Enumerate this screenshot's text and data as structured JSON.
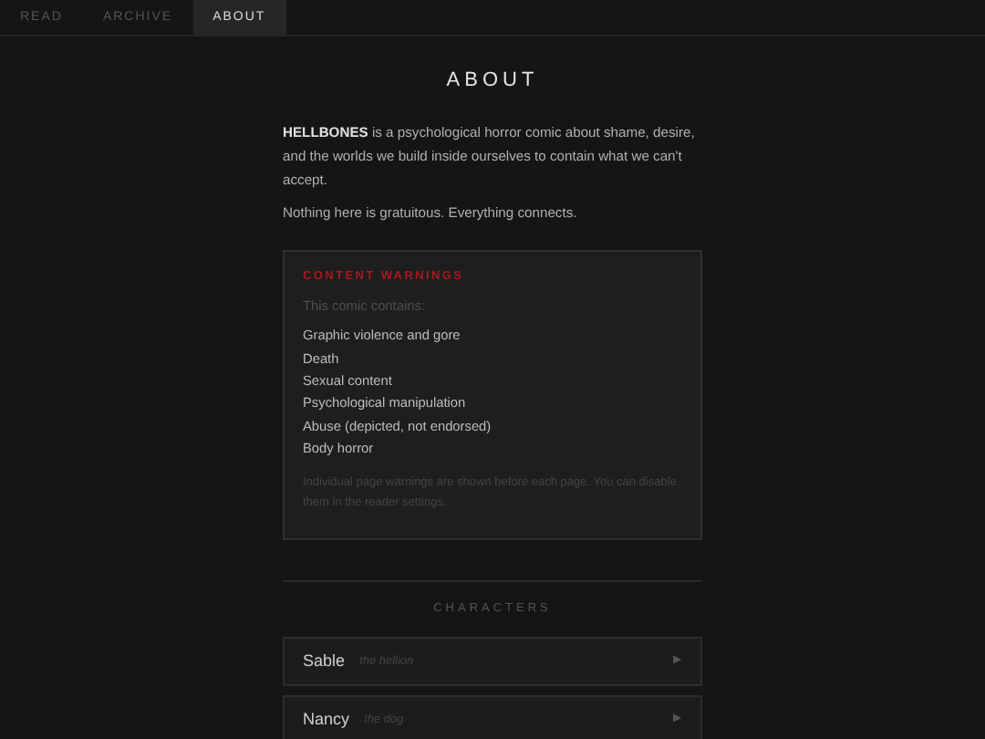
{
  "tabs": [
    {
      "label": "READ",
      "selected": false
    },
    {
      "label": "ARCHIVE",
      "selected": false
    },
    {
      "label": "ABOUT",
      "selected": true
    }
  ],
  "title": "ABOUT",
  "intro": [
    "**HELLBONES** is a psychological horror comic about shame, desire, and the worlds we build inside ourselves to contain what we can't accept.",
    "Nothing here is gratuitous. Everything connects."
  ],
  "content_warnings": {
    "heading": "CONTENT WARNINGS",
    "lead": "This comic contains:",
    "items": [
      "Graphic violence and gore",
      "Death",
      "Sexual content",
      "Psychological manipulation",
      "Abuse (depicted, not endorsed)",
      "Body horror"
    ],
    "note": "Individual page warnings are shown before each page. You can disable them in the reader settings."
  },
  "characters": {
    "heading": "CHARACTERS",
    "items": [
      {
        "name": "Sable",
        "epithet": "the hellion",
        "arrow": "▶"
      },
      {
        "name": "Nancy",
        "epithet": "the dog",
        "arrow": "▶"
      }
    ]
  }
}
